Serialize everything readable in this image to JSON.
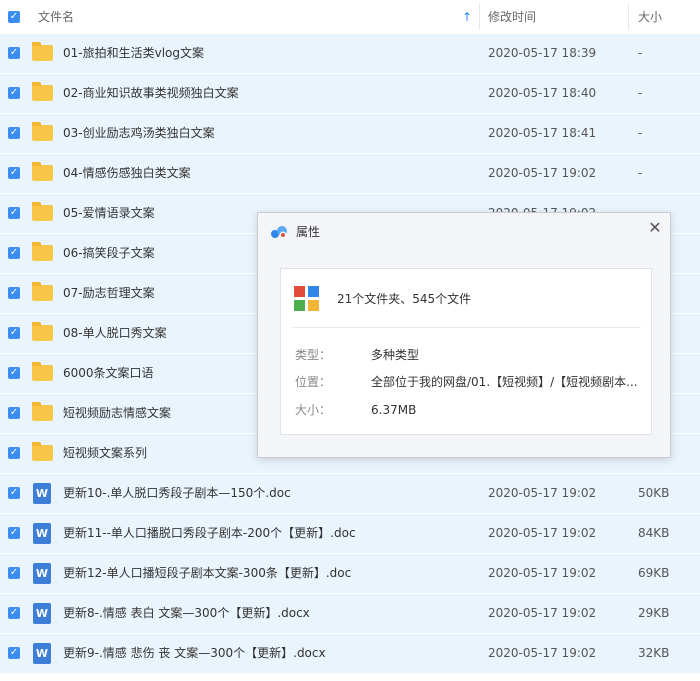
{
  "header": {
    "name_label": "文件名",
    "mtime_label": "修改时间",
    "size_label": "大小",
    "sort_arrow": "↑"
  },
  "rows": [
    {
      "name": "01-旅拍和生活类vlog文案",
      "mtime": "2020-05-17 18:39",
      "size": "-",
      "type": "folder"
    },
    {
      "name": "02-商业知识故事类视频独白文案",
      "mtime": "2020-05-17 18:40",
      "size": "-",
      "type": "folder"
    },
    {
      "name": "03-创业励志鸡汤类独白文案",
      "mtime": "2020-05-17 18:41",
      "size": "-",
      "type": "folder"
    },
    {
      "name": "04-情感伤感独白类文案",
      "mtime": "2020-05-17 19:02",
      "size": "-",
      "type": "folder"
    },
    {
      "name": "05-爱情语录文案",
      "mtime": "2020-05-17 19:02",
      "size": "-",
      "type": "folder"
    },
    {
      "name": "06-搞笑段子文案",
      "mtime": "",
      "size": "",
      "type": "folder"
    },
    {
      "name": "07-励志哲理文案",
      "mtime": "",
      "size": "",
      "type": "folder"
    },
    {
      "name": "08-单人脱口秀文案",
      "mtime": "",
      "size": "",
      "type": "folder"
    },
    {
      "name": "6000条文案口语",
      "mtime": "",
      "size": "",
      "type": "folder"
    },
    {
      "name": "短视频励志情感文案",
      "mtime": "",
      "size": "",
      "type": "folder"
    },
    {
      "name": "短视频文案系列",
      "mtime": "2020-05-17 19:02",
      "size": "",
      "type": "folder"
    },
    {
      "name": "更新10-.单人脱口秀段子剧本—150个.doc",
      "mtime": "2020-05-17 19:02",
      "size": "50KB",
      "type": "doc"
    },
    {
      "name": "更新11--单人口播脱口秀段子剧本-200个【更新】.doc",
      "mtime": "2020-05-17 19:02",
      "size": "84KB",
      "type": "doc"
    },
    {
      "name": "更新12-单人口播短段子剧本文案-300条【更新】.doc",
      "mtime": "2020-05-17 19:02",
      "size": "69KB",
      "type": "doc"
    },
    {
      "name": "更新8-.情感 表白 文案—300个【更新】.docx",
      "mtime": "2020-05-17 19:02",
      "size": "29KB",
      "type": "doc"
    },
    {
      "name": "更新9-.情感 悲伤 丧 文案—300个【更新】.docx",
      "mtime": "2020-05-17 19:02",
      "size": "32KB",
      "type": "doc"
    }
  ],
  "dialog": {
    "title": "属性",
    "close": "✕",
    "summary": "21个文件夹、545个文件",
    "type_label": "类型：",
    "type_value": "多种类型",
    "location_label": "位置：",
    "location_value": "全部位于我的网盘/01.【短视频】/【短视频剧本...",
    "size_label": "大小：",
    "size_value": "6.37MB"
  },
  "checkbox_mark": "✓",
  "doc_icon_letter": "W",
  "colors": {
    "row_bg": "#eaf4fd",
    "checkbox": "#3b8ef0",
    "folder": "#f7c646",
    "doc_icon": "#3c7ed8"
  }
}
